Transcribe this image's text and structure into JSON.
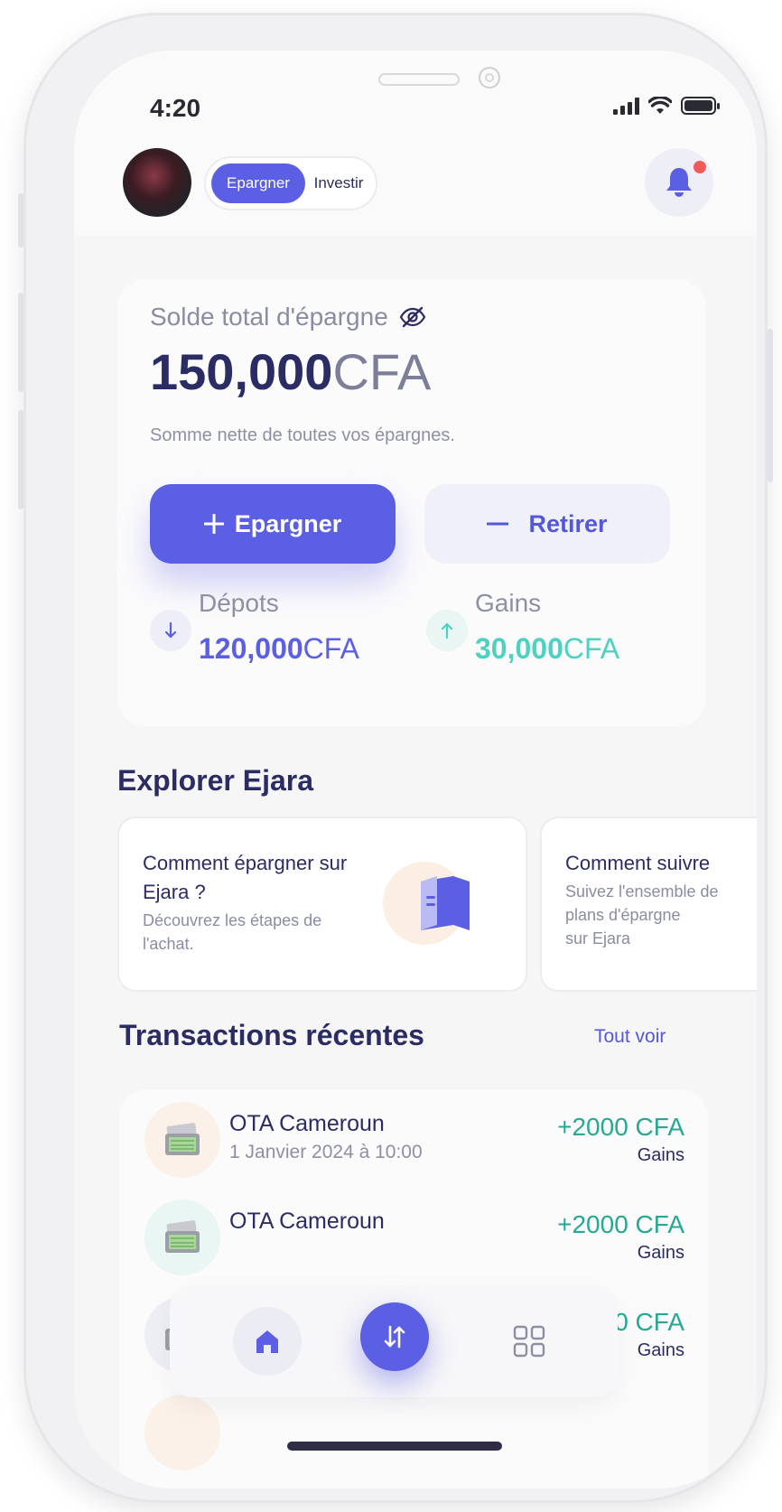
{
  "status_bar": {
    "time": "4:20"
  },
  "header": {
    "toggle": {
      "active_label": "Epargner",
      "inactive_label": "Investir"
    }
  },
  "savings": {
    "label": "Solde total d'épargne",
    "balance_amount": "150,000",
    "balance_currency": "CFA",
    "subtitle": "Somme nette de toutes vos épargnes.",
    "save_button": "Epargner",
    "withdraw_button": "Retirer",
    "deposits": {
      "label": "Dépots",
      "amount": "120,000",
      "currency": "CFA"
    },
    "gains": {
      "label": "Gains",
      "amount": "30,000",
      "currency": "CFA"
    }
  },
  "explore": {
    "title": "Explorer Ejara",
    "cards": [
      {
        "title_line1": "Comment épargner sur",
        "title_line2": "Ejara ?",
        "desc_line1": "Découvrez les étapes de",
        "desc_line2": "l'achat."
      },
      {
        "title_line1": "Comment suivre",
        "desc_line1": "Suivez l'ensemble de",
        "desc_line2": "plans d'épargne",
        "desc_line3": "sur Ejara"
      }
    ]
  },
  "transactions": {
    "title": "Transactions récentes",
    "see_all": "Tout voir",
    "items": [
      {
        "name": "OTA Cameroun",
        "date": "1 Janvier 2024 à 10:00",
        "amount": "+2000 CFA",
        "type": "Gains"
      },
      {
        "name": "OTA Cameroun",
        "amount": "+2000 CFA",
        "type": "Gains"
      },
      {
        "amount": "+2000 CFA",
        "type": "Gains"
      }
    ]
  },
  "colors": {
    "accent": "#5b5fe3",
    "positive": "#27a894",
    "gains_teal": "#4fd1c1",
    "title_navy": "#2a2c63",
    "notification_dot": "#ef5b5b"
  },
  "icons": {
    "nav": [
      "home-icon",
      "swap-icon",
      "grid-icon"
    ],
    "visibility": "eye-slash-icon",
    "notifications": "bell-icon"
  }
}
